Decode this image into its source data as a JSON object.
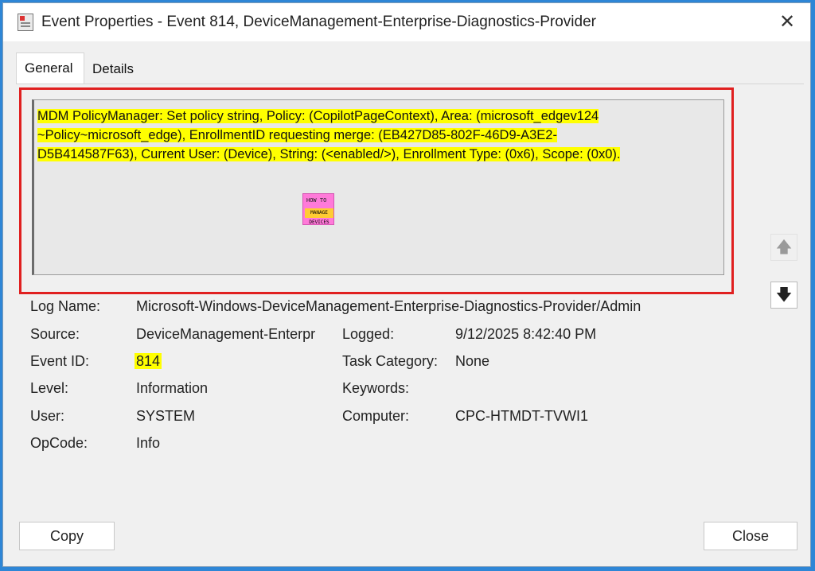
{
  "window": {
    "title": "Event Properties - Event 814, DeviceManagement-Enterprise-Diagnostics-Provider"
  },
  "tabs": [
    {
      "label": "General",
      "active": true
    },
    {
      "label": "Details",
      "active": false
    }
  ],
  "description": {
    "line1": "MDM PolicyManager: Set policy string, Policy: (CopilotPageContext), Area: (microsoft_edgev124",
    "line2": "~Policy~microsoft_edge), EnrollmentID requesting merge: (EB427D85-802F-46D9-A3E2-",
    "line3": "D5B414587F63), Current User: (Device), String: (<enabled/>), Enrollment Type: (0x6), Scope: (0x0)."
  },
  "fields": {
    "log_name_label": "Log Name:",
    "log_name_value": "Microsoft-Windows-DeviceManagement-Enterprise-Diagnostics-Provider/Admin",
    "source_label": "Source:",
    "source_value": "DeviceManagement-Enterpr",
    "logged_label": "Logged:",
    "logged_value": "9/12/2025 8:42:40 PM",
    "event_id_label": "Event ID:",
    "event_id_value": "814",
    "task_category_label": "Task Category:",
    "task_category_value": "None",
    "level_label": "Level:",
    "level_value": "Information",
    "keywords_label": "Keywords:",
    "keywords_value": "",
    "user_label": "User:",
    "user_value": "SYSTEM",
    "computer_label": "Computer:",
    "computer_value": "CPC-HTMDT-TVWI1",
    "opcode_label": "OpCode:",
    "opcode_value": "Info"
  },
  "logo": {
    "line1": "HOW TO",
    "line2": "MANAGE DEVICES"
  },
  "buttons": {
    "copy": "Copy",
    "close": "Close"
  },
  "icons": {
    "close": "close-icon",
    "scroll_up": "arrow-up-icon",
    "scroll_down": "arrow-down-icon",
    "app": "event-viewer-icon"
  },
  "colors": {
    "highlight": "#ffff00",
    "annotation_frame": "#e02020",
    "outer_border": "#2e86d6"
  }
}
